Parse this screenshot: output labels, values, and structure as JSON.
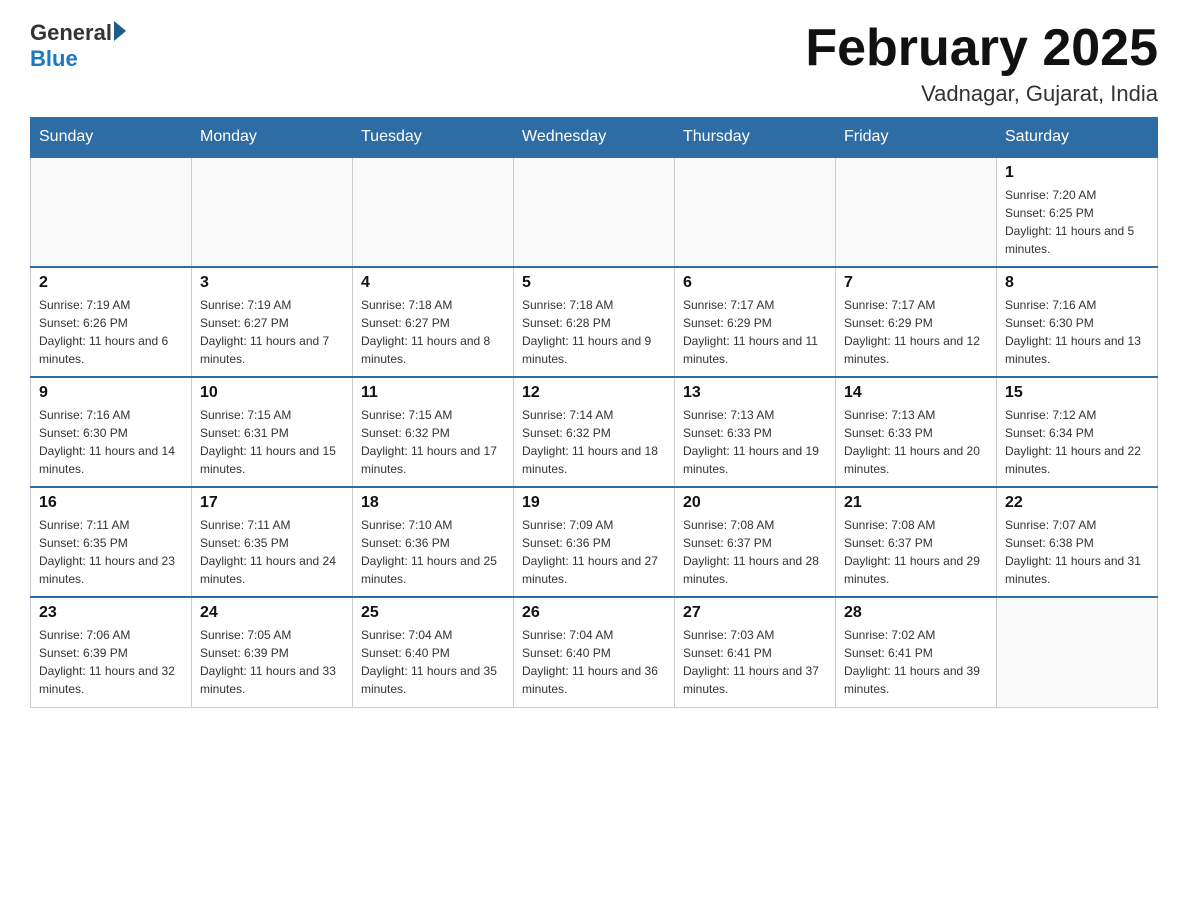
{
  "header": {
    "logo": {
      "general": "General",
      "arrow": "▶",
      "blue": "Blue"
    },
    "title": "February 2025",
    "location": "Vadnagar, Gujarat, India"
  },
  "days_of_week": [
    "Sunday",
    "Monday",
    "Tuesday",
    "Wednesday",
    "Thursday",
    "Friday",
    "Saturday"
  ],
  "weeks": [
    {
      "cells": [
        {
          "empty": true
        },
        {
          "empty": true
        },
        {
          "empty": true
        },
        {
          "empty": true
        },
        {
          "empty": true
        },
        {
          "empty": true
        },
        {
          "day": "1",
          "sunrise": "Sunrise: 7:20 AM",
          "sunset": "Sunset: 6:25 PM",
          "daylight": "Daylight: 11 hours and 5 minutes."
        }
      ]
    },
    {
      "cells": [
        {
          "day": "2",
          "sunrise": "Sunrise: 7:19 AM",
          "sunset": "Sunset: 6:26 PM",
          "daylight": "Daylight: 11 hours and 6 minutes."
        },
        {
          "day": "3",
          "sunrise": "Sunrise: 7:19 AM",
          "sunset": "Sunset: 6:27 PM",
          "daylight": "Daylight: 11 hours and 7 minutes."
        },
        {
          "day": "4",
          "sunrise": "Sunrise: 7:18 AM",
          "sunset": "Sunset: 6:27 PM",
          "daylight": "Daylight: 11 hours and 8 minutes."
        },
        {
          "day": "5",
          "sunrise": "Sunrise: 7:18 AM",
          "sunset": "Sunset: 6:28 PM",
          "daylight": "Daylight: 11 hours and 9 minutes."
        },
        {
          "day": "6",
          "sunrise": "Sunrise: 7:17 AM",
          "sunset": "Sunset: 6:29 PM",
          "daylight": "Daylight: 11 hours and 11 minutes."
        },
        {
          "day": "7",
          "sunrise": "Sunrise: 7:17 AM",
          "sunset": "Sunset: 6:29 PM",
          "daylight": "Daylight: 11 hours and 12 minutes."
        },
        {
          "day": "8",
          "sunrise": "Sunrise: 7:16 AM",
          "sunset": "Sunset: 6:30 PM",
          "daylight": "Daylight: 11 hours and 13 minutes."
        }
      ]
    },
    {
      "cells": [
        {
          "day": "9",
          "sunrise": "Sunrise: 7:16 AM",
          "sunset": "Sunset: 6:30 PM",
          "daylight": "Daylight: 11 hours and 14 minutes."
        },
        {
          "day": "10",
          "sunrise": "Sunrise: 7:15 AM",
          "sunset": "Sunset: 6:31 PM",
          "daylight": "Daylight: 11 hours and 15 minutes."
        },
        {
          "day": "11",
          "sunrise": "Sunrise: 7:15 AM",
          "sunset": "Sunset: 6:32 PM",
          "daylight": "Daylight: 11 hours and 17 minutes."
        },
        {
          "day": "12",
          "sunrise": "Sunrise: 7:14 AM",
          "sunset": "Sunset: 6:32 PM",
          "daylight": "Daylight: 11 hours and 18 minutes."
        },
        {
          "day": "13",
          "sunrise": "Sunrise: 7:13 AM",
          "sunset": "Sunset: 6:33 PM",
          "daylight": "Daylight: 11 hours and 19 minutes."
        },
        {
          "day": "14",
          "sunrise": "Sunrise: 7:13 AM",
          "sunset": "Sunset: 6:33 PM",
          "daylight": "Daylight: 11 hours and 20 minutes."
        },
        {
          "day": "15",
          "sunrise": "Sunrise: 7:12 AM",
          "sunset": "Sunset: 6:34 PM",
          "daylight": "Daylight: 11 hours and 22 minutes."
        }
      ]
    },
    {
      "cells": [
        {
          "day": "16",
          "sunrise": "Sunrise: 7:11 AM",
          "sunset": "Sunset: 6:35 PM",
          "daylight": "Daylight: 11 hours and 23 minutes."
        },
        {
          "day": "17",
          "sunrise": "Sunrise: 7:11 AM",
          "sunset": "Sunset: 6:35 PM",
          "daylight": "Daylight: 11 hours and 24 minutes."
        },
        {
          "day": "18",
          "sunrise": "Sunrise: 7:10 AM",
          "sunset": "Sunset: 6:36 PM",
          "daylight": "Daylight: 11 hours and 25 minutes."
        },
        {
          "day": "19",
          "sunrise": "Sunrise: 7:09 AM",
          "sunset": "Sunset: 6:36 PM",
          "daylight": "Daylight: 11 hours and 27 minutes."
        },
        {
          "day": "20",
          "sunrise": "Sunrise: 7:08 AM",
          "sunset": "Sunset: 6:37 PM",
          "daylight": "Daylight: 11 hours and 28 minutes."
        },
        {
          "day": "21",
          "sunrise": "Sunrise: 7:08 AM",
          "sunset": "Sunset: 6:37 PM",
          "daylight": "Daylight: 11 hours and 29 minutes."
        },
        {
          "day": "22",
          "sunrise": "Sunrise: 7:07 AM",
          "sunset": "Sunset: 6:38 PM",
          "daylight": "Daylight: 11 hours and 31 minutes."
        }
      ]
    },
    {
      "cells": [
        {
          "day": "23",
          "sunrise": "Sunrise: 7:06 AM",
          "sunset": "Sunset: 6:39 PM",
          "daylight": "Daylight: 11 hours and 32 minutes."
        },
        {
          "day": "24",
          "sunrise": "Sunrise: 7:05 AM",
          "sunset": "Sunset: 6:39 PM",
          "daylight": "Daylight: 11 hours and 33 minutes."
        },
        {
          "day": "25",
          "sunrise": "Sunrise: 7:04 AM",
          "sunset": "Sunset: 6:40 PM",
          "daylight": "Daylight: 11 hours and 35 minutes."
        },
        {
          "day": "26",
          "sunrise": "Sunrise: 7:04 AM",
          "sunset": "Sunset: 6:40 PM",
          "daylight": "Daylight: 11 hours and 36 minutes."
        },
        {
          "day": "27",
          "sunrise": "Sunrise: 7:03 AM",
          "sunset": "Sunset: 6:41 PM",
          "daylight": "Daylight: 11 hours and 37 minutes."
        },
        {
          "day": "28",
          "sunrise": "Sunrise: 7:02 AM",
          "sunset": "Sunset: 6:41 PM",
          "daylight": "Daylight: 11 hours and 39 minutes."
        },
        {
          "empty": true
        }
      ]
    }
  ]
}
